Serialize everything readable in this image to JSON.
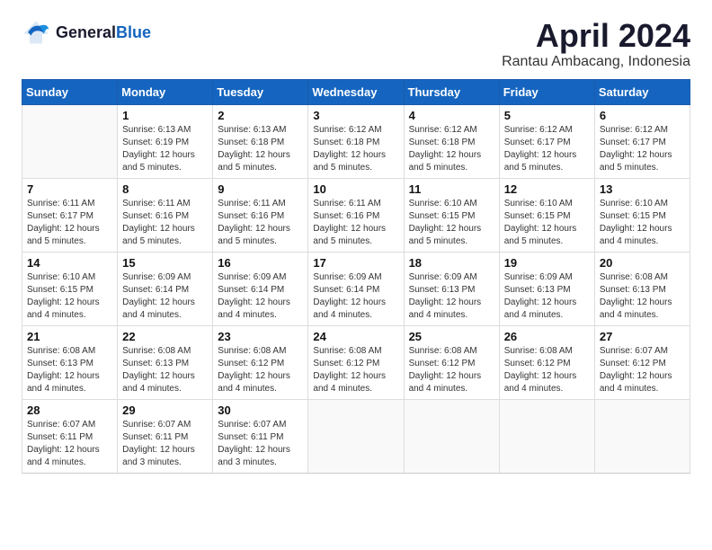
{
  "logo": {
    "text_general": "General",
    "text_blue": "Blue"
  },
  "title": "April 2024",
  "subtitle": "Rantau Ambacang, Indonesia",
  "columns": [
    "Sunday",
    "Monday",
    "Tuesday",
    "Wednesday",
    "Thursday",
    "Friday",
    "Saturday"
  ],
  "weeks": [
    [
      {
        "day": "",
        "info": ""
      },
      {
        "day": "1",
        "info": "Sunrise: 6:13 AM\nSunset: 6:19 PM\nDaylight: 12 hours\nand 5 minutes."
      },
      {
        "day": "2",
        "info": "Sunrise: 6:13 AM\nSunset: 6:18 PM\nDaylight: 12 hours\nand 5 minutes."
      },
      {
        "day": "3",
        "info": "Sunrise: 6:12 AM\nSunset: 6:18 PM\nDaylight: 12 hours\nand 5 minutes."
      },
      {
        "day": "4",
        "info": "Sunrise: 6:12 AM\nSunset: 6:18 PM\nDaylight: 12 hours\nand 5 minutes."
      },
      {
        "day": "5",
        "info": "Sunrise: 6:12 AM\nSunset: 6:17 PM\nDaylight: 12 hours\nand 5 minutes."
      },
      {
        "day": "6",
        "info": "Sunrise: 6:12 AM\nSunset: 6:17 PM\nDaylight: 12 hours\nand 5 minutes."
      }
    ],
    [
      {
        "day": "7",
        "info": "Sunrise: 6:11 AM\nSunset: 6:17 PM\nDaylight: 12 hours\nand 5 minutes."
      },
      {
        "day": "8",
        "info": "Sunrise: 6:11 AM\nSunset: 6:16 PM\nDaylight: 12 hours\nand 5 minutes."
      },
      {
        "day": "9",
        "info": "Sunrise: 6:11 AM\nSunset: 6:16 PM\nDaylight: 12 hours\nand 5 minutes."
      },
      {
        "day": "10",
        "info": "Sunrise: 6:11 AM\nSunset: 6:16 PM\nDaylight: 12 hours\nand 5 minutes."
      },
      {
        "day": "11",
        "info": "Sunrise: 6:10 AM\nSunset: 6:15 PM\nDaylight: 12 hours\nand 5 minutes."
      },
      {
        "day": "12",
        "info": "Sunrise: 6:10 AM\nSunset: 6:15 PM\nDaylight: 12 hours\nand 5 minutes."
      },
      {
        "day": "13",
        "info": "Sunrise: 6:10 AM\nSunset: 6:15 PM\nDaylight: 12 hours\nand 4 minutes."
      }
    ],
    [
      {
        "day": "14",
        "info": "Sunrise: 6:10 AM\nSunset: 6:15 PM\nDaylight: 12 hours\nand 4 minutes."
      },
      {
        "day": "15",
        "info": "Sunrise: 6:09 AM\nSunset: 6:14 PM\nDaylight: 12 hours\nand 4 minutes."
      },
      {
        "day": "16",
        "info": "Sunrise: 6:09 AM\nSunset: 6:14 PM\nDaylight: 12 hours\nand 4 minutes."
      },
      {
        "day": "17",
        "info": "Sunrise: 6:09 AM\nSunset: 6:14 PM\nDaylight: 12 hours\nand 4 minutes."
      },
      {
        "day": "18",
        "info": "Sunrise: 6:09 AM\nSunset: 6:13 PM\nDaylight: 12 hours\nand 4 minutes."
      },
      {
        "day": "19",
        "info": "Sunrise: 6:09 AM\nSunset: 6:13 PM\nDaylight: 12 hours\nand 4 minutes."
      },
      {
        "day": "20",
        "info": "Sunrise: 6:08 AM\nSunset: 6:13 PM\nDaylight: 12 hours\nand 4 minutes."
      }
    ],
    [
      {
        "day": "21",
        "info": "Sunrise: 6:08 AM\nSunset: 6:13 PM\nDaylight: 12 hours\nand 4 minutes."
      },
      {
        "day": "22",
        "info": "Sunrise: 6:08 AM\nSunset: 6:13 PM\nDaylight: 12 hours\nand 4 minutes."
      },
      {
        "day": "23",
        "info": "Sunrise: 6:08 AM\nSunset: 6:12 PM\nDaylight: 12 hours\nand 4 minutes."
      },
      {
        "day": "24",
        "info": "Sunrise: 6:08 AM\nSunset: 6:12 PM\nDaylight: 12 hours\nand 4 minutes."
      },
      {
        "day": "25",
        "info": "Sunrise: 6:08 AM\nSunset: 6:12 PM\nDaylight: 12 hours\nand 4 minutes."
      },
      {
        "day": "26",
        "info": "Sunrise: 6:08 AM\nSunset: 6:12 PM\nDaylight: 12 hours\nand 4 minutes."
      },
      {
        "day": "27",
        "info": "Sunrise: 6:07 AM\nSunset: 6:12 PM\nDaylight: 12 hours\nand 4 minutes."
      }
    ],
    [
      {
        "day": "28",
        "info": "Sunrise: 6:07 AM\nSunset: 6:11 PM\nDaylight: 12 hours\nand 4 minutes."
      },
      {
        "day": "29",
        "info": "Sunrise: 6:07 AM\nSunset: 6:11 PM\nDaylight: 12 hours\nand 3 minutes."
      },
      {
        "day": "30",
        "info": "Sunrise: 6:07 AM\nSunset: 6:11 PM\nDaylight: 12 hours\nand 3 minutes."
      },
      {
        "day": "",
        "info": ""
      },
      {
        "day": "",
        "info": ""
      },
      {
        "day": "",
        "info": ""
      },
      {
        "day": "",
        "info": ""
      }
    ]
  ]
}
